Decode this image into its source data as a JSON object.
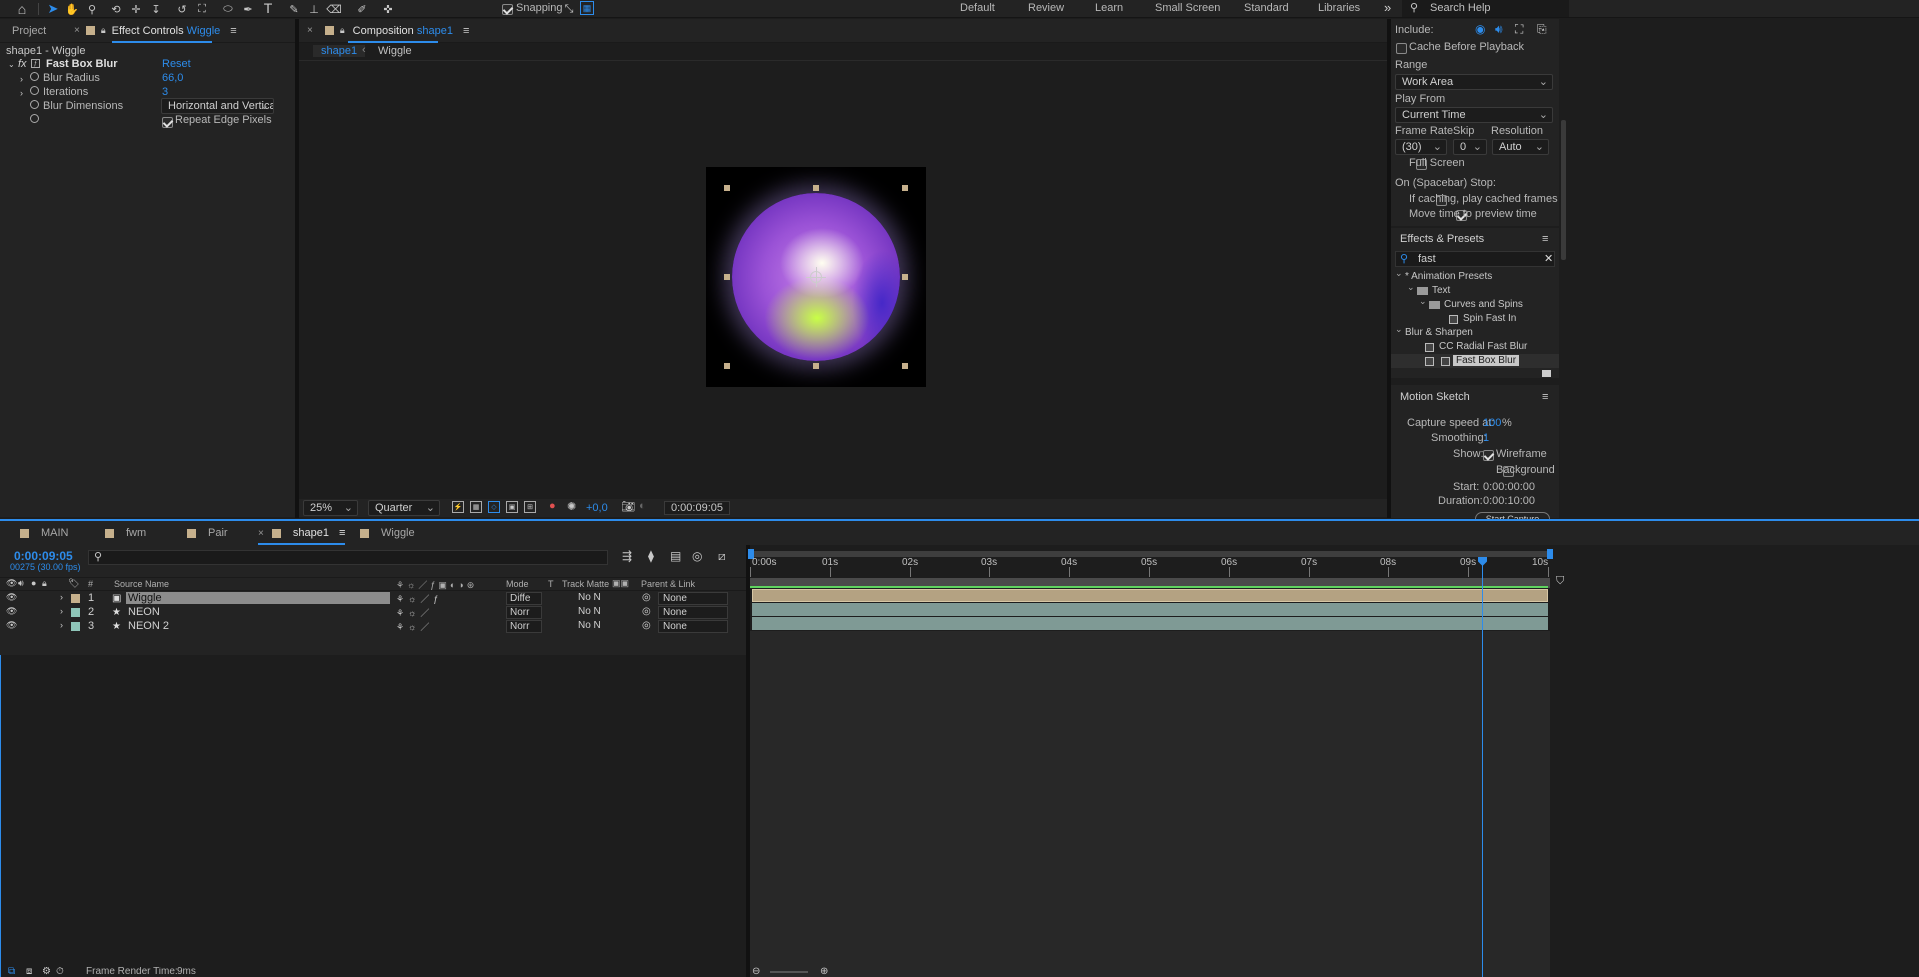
{
  "toolbar": {
    "snapping_label": "Snapping",
    "workspaces": [
      "Default",
      "Review",
      "Learn",
      "Small Screen",
      "Standard",
      "Libraries"
    ],
    "more": "»",
    "search_help_placeholder": "Search Help"
  },
  "effect_controls": {
    "tab_project": "Project",
    "tab_effect_controls": "Effect Controls",
    "tab_effect_controls_layer": "Wiggle",
    "breadcrumb": "shape1 - Wiggle",
    "effect_name": "Fast Box Blur",
    "reset_label": "Reset",
    "blur_radius_label": "Blur Radius",
    "blur_radius_value": "66,0",
    "iterations_label": "Iterations",
    "iterations_value": "3",
    "blur_dimensions_label": "Blur Dimensions",
    "blur_dimensions_value": "Horizontal and Vertical",
    "repeat_edge_label": "Repeat Edge Pixels"
  },
  "composition": {
    "tab_label": "Composition",
    "tab_comp_name": "shape1",
    "crumb_1": "shape1",
    "crumb_2": "Wiggle",
    "zoom_value": "25%",
    "resolution_value": "Quarter",
    "exposure_value": "+0,0",
    "timecode": "0:00:09:05"
  },
  "preview": {
    "include_label": "Include:",
    "cache_label": "Cache Before Playback",
    "range_label": "Range",
    "range_value": "Work Area",
    "play_from_label": "Play From",
    "play_from_value": "Current Time",
    "frame_rate_label": "Frame Rate",
    "skip_label": "Skip",
    "resolution_label": "Resolution",
    "frame_rate_value": "(30)",
    "skip_value": "0",
    "resolution_value": "Auto",
    "full_screen_label": "Full Screen",
    "on_stop_label": "On (Spacebar) Stop:",
    "if_caching_label": "If caching, play cached frames",
    "move_time_label": "Move time to preview time"
  },
  "effects_presets": {
    "title": "Effects & Presets",
    "search_value": "fast",
    "tree": [
      {
        "label": "* Animation Presets",
        "indent": 0,
        "kind": "group"
      },
      {
        "label": "Text",
        "indent": 1,
        "kind": "folder"
      },
      {
        "label": "Curves and Spins",
        "indent": 2,
        "kind": "folder"
      },
      {
        "label": "Spin Fast In",
        "indent": 3,
        "kind": "preset"
      },
      {
        "label": "Blur & Sharpen",
        "indent": 0,
        "kind": "group"
      },
      {
        "label": "CC Radial Fast Blur",
        "indent": 1,
        "kind": "effect"
      },
      {
        "label": "Fast Box Blur",
        "indent": 1,
        "kind": "effect",
        "selected": true
      }
    ]
  },
  "motion_sketch": {
    "title": "Motion Sketch",
    "capture_label": "Capture speed at:",
    "capture_value": "100",
    "capture_unit": "%",
    "smoothing_label": "Smoothing:",
    "smoothing_value": "1",
    "show_label": "Show:",
    "wireframe_label": "Wireframe",
    "background_label": "Background",
    "start_label": "Start:",
    "start_value": "0:00:00:00",
    "duration_label": "Duration:",
    "duration_value": "0:00:10:00",
    "start_capture_label": "Start Capture"
  },
  "timeline": {
    "tabs": [
      {
        "label": "MAIN",
        "color": "#c6b08c"
      },
      {
        "label": "fwm",
        "color": "#c6b08c"
      },
      {
        "label": "Pair",
        "color": "#c6b08c"
      },
      {
        "label": "shape1",
        "color": "#c6b08c",
        "active": true
      },
      {
        "label": "Wiggle",
        "color": "#c6b08c"
      }
    ],
    "current_time": "0:00:09:05",
    "frame_info": "00275 (30.00 fps)",
    "col_hash": "#",
    "col_source_name": "Source Name",
    "col_mode": "Mode",
    "col_t": "T",
    "col_track_matte": "Track Matte",
    "col_parent": "Parent & Link",
    "layers": [
      {
        "num": "1",
        "name": "Wiggle",
        "mode": "Diffe",
        "matte": "No N",
        "parent": "None",
        "color": "#c6b08c",
        "selected": true
      },
      {
        "num": "2",
        "name": "NEON",
        "mode": "Norr",
        "matte": "No N",
        "parent": "None",
        "color": "#8fc6b9"
      },
      {
        "num": "3",
        "name": "NEON 2",
        "mode": "Norr",
        "matte": "No N",
        "parent": "None",
        "color": "#8fc6b9"
      }
    ],
    "ruler_labels": [
      "0:00s",
      "01s",
      "02s",
      "03s",
      "04s",
      "05s",
      "06s",
      "07s",
      "08s",
      "09s",
      "10s"
    ],
    "playhead_seconds": 9.17,
    "render_time_label": "Frame Render Time:",
    "render_time_value": "9ms"
  }
}
